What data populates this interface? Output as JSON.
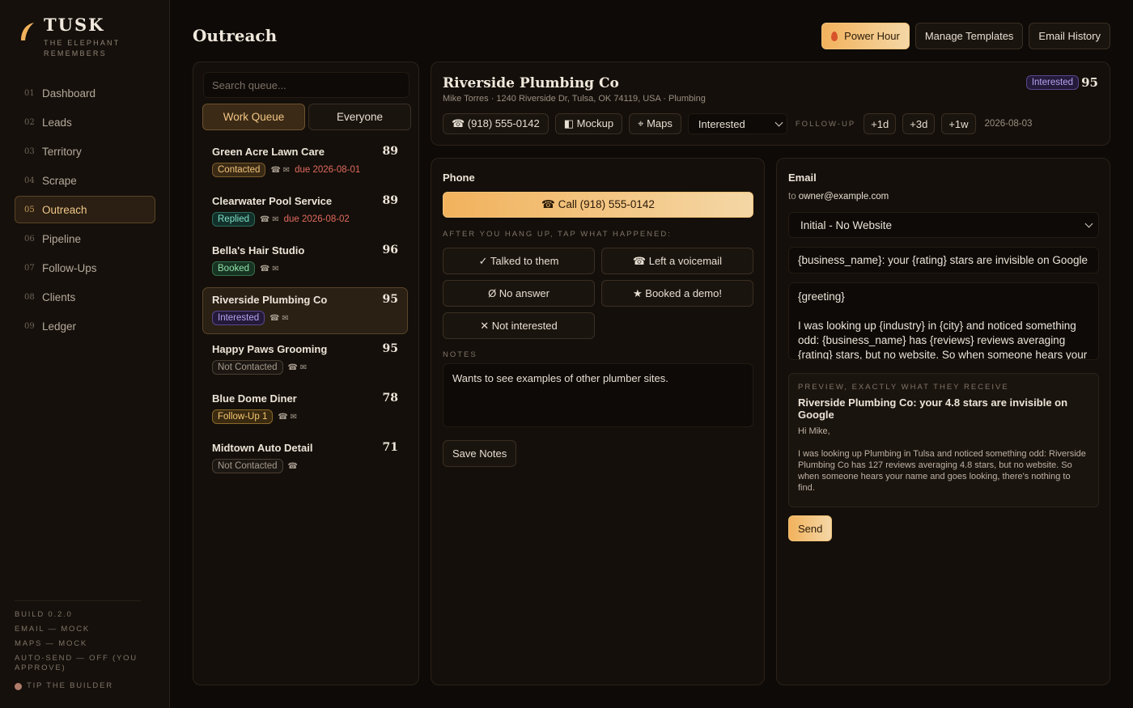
{
  "brand": {
    "title": "TUSK",
    "subtitle": "THE ELEPHANT REMEMBERS"
  },
  "nav": [
    {
      "num": "01",
      "label": "Dashboard"
    },
    {
      "num": "02",
      "label": "Leads"
    },
    {
      "num": "03",
      "label": "Territory"
    },
    {
      "num": "04",
      "label": "Scrape"
    },
    {
      "num": "05",
      "label": "Outreach",
      "active": true
    },
    {
      "num": "06",
      "label": "Pipeline"
    },
    {
      "num": "07",
      "label": "Follow-Ups"
    },
    {
      "num": "08",
      "label": "Clients"
    },
    {
      "num": "09",
      "label": "Ledger"
    }
  ],
  "footer": {
    "build": "BUILD 0.2.0",
    "email": "EMAIL — MOCK",
    "maps": "MAPS — MOCK",
    "autosend": "AUTO-SEND — OFF (YOU APPROVE)",
    "tip": "TIP THE BUILDER"
  },
  "page": {
    "title": "Outreach"
  },
  "top_actions": {
    "power_hour": "Power Hour",
    "manage_templates": "Manage Templates",
    "email_history": "Email History"
  },
  "queue": {
    "search_placeholder": "Search queue...",
    "tabs": [
      "Work Queue",
      "Everyone"
    ],
    "items": [
      {
        "name": "Green Acre Lawn Care",
        "score": "89",
        "status": "Contacted",
        "status_class": "b-contacted",
        "icons": "☎ ✉",
        "due": "due 2026-08-01"
      },
      {
        "name": "Clearwater Pool Service",
        "score": "89",
        "status": "Replied",
        "status_class": "b-replied",
        "icons": "☎ ✉",
        "due": "due 2026-08-02"
      },
      {
        "name": "Bella's Hair Studio",
        "score": "96",
        "status": "Booked",
        "status_class": "b-booked",
        "icons": "☎ ✉",
        "due": ""
      },
      {
        "name": "Riverside Plumbing Co",
        "score": "95",
        "status": "Interested",
        "status_class": "b-interested",
        "icons": "☎ ✉",
        "due": "",
        "active": true
      },
      {
        "name": "Happy Paws Grooming",
        "score": "95",
        "status": "Not Contacted",
        "status_class": "b-notc",
        "icons": "☎ ✉",
        "due": ""
      },
      {
        "name": "Blue Dome Diner",
        "score": "78",
        "status": "Follow-Up 1",
        "status_class": "b-follow",
        "icons": "☎ ✉",
        "due": ""
      },
      {
        "name": "Midtown Auto Detail",
        "score": "71",
        "status": "Not Contacted",
        "status_class": "b-notc",
        "icons": "☎",
        "due": ""
      }
    ]
  },
  "lead": {
    "name": "Riverside Plumbing Co",
    "subtitle": "Mike Torres · 1240 Riverside Dr, Tulsa, OK 74119, USA · Plumbing",
    "status": "Interested",
    "score": "95",
    "phone_btn": "☎ (918) 555-0142",
    "mockup_btn": "◧ Mockup",
    "maps_btn": "⌖ Maps",
    "status_select": "Interested",
    "followup_label": "FOLLOW-UP",
    "fu_1d": "+1d",
    "fu_3d": "+3d",
    "fu_1w": "+1w",
    "followup_date": "2026-08-03"
  },
  "phone": {
    "title": "Phone",
    "call_btn": "☎ Call (918) 555-0142",
    "after_label": "AFTER YOU HANG UP, TAP WHAT HAPPENED:",
    "outcomes": [
      "✓ Talked to them",
      "☎ Left a voicemail",
      "Ø No answer",
      "★ Booked a demo!",
      "✕ Not interested"
    ],
    "notes_label": "NOTES",
    "notes_value": "Wants to see examples of other plumber sites.",
    "save_btn": "Save Notes"
  },
  "email": {
    "title": "Email",
    "to_prefix": "to",
    "to": "owner@example.com",
    "template": "Initial - No Website",
    "subject": "{business_name}: your {rating} stars are invisible on Google",
    "body": "{greeting}\n\nI was looking up {industry} in {city} and noticed something odd: {business_name} has {reviews} reviews averaging {rating} stars, but no website. So when someone hears your",
    "preview_label": "PREVIEW, EXACTLY WHAT THEY RECEIVE",
    "preview_subject": "Riverside Plumbing Co: your 4.8 stars are invisible on Google",
    "preview_body": "Hi Mike,\n\nI was looking up Plumbing in Tulsa and noticed something odd: Riverside Plumbing Co has 127 reviews averaging 4.8 stars, but no website. So when someone hears your name and goes looking, there's nothing to find.\n\nThat gap is where jobs quietly go to whoever shows up instead.",
    "send_btn": "Send"
  },
  "colors": {
    "accent": "#f2b25c",
    "background": "#0d0a07",
    "panel": "#140f0a"
  }
}
